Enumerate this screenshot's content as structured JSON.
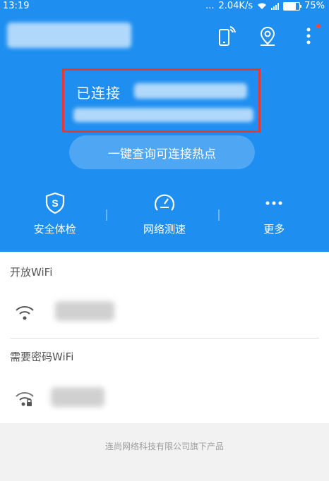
{
  "status_bar": {
    "time": "13:19",
    "dots": "...",
    "speed": "2.04K/s",
    "battery": "75%",
    "battery_level": 0.75
  },
  "header": {
    "icons": [
      "phone-transfer-icon",
      "location-pin-icon",
      "more-vert-icon"
    ]
  },
  "connection": {
    "connected_label": "已连接"
  },
  "query_button": {
    "label": "一键查询可连接热点"
  },
  "tools": [
    {
      "label": "安全体检",
      "icon": "shield-s-icon"
    },
    {
      "label": "网络测速",
      "icon": "speedometer-icon"
    },
    {
      "label": "更多",
      "icon": "more-dots-icon"
    }
  ],
  "sections": {
    "open_title": "开放WiFi",
    "password_title": "需要密码WiFi"
  },
  "footer": {
    "text": "连尚网络科技有限公司旗下产品"
  },
  "colors": {
    "primary": "#1e8ff0",
    "highlight": "#e53935",
    "badge": "#ff4433"
  }
}
